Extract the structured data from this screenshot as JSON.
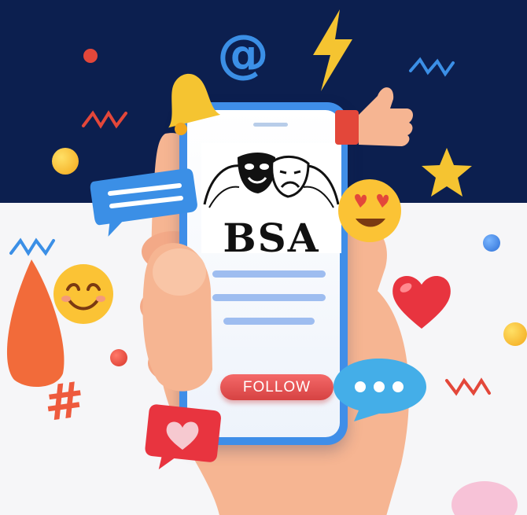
{
  "brand": {
    "logo_text": "BSA",
    "logo_icon": "theatre-masks-icon"
  },
  "cta": {
    "follow_label": "FOLLOW"
  },
  "decor": {
    "hashtag_symbol": "#",
    "at_symbol": "@"
  },
  "colors": {
    "navy_background": "#0c1f4f",
    "phone_blue": "#3f8ee8",
    "follow_button": "#e14f4f"
  }
}
